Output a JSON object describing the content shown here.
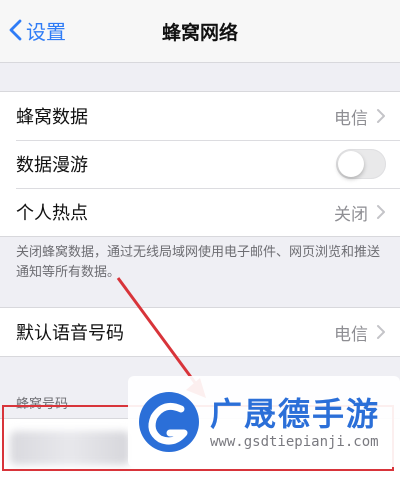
{
  "nav": {
    "back_label": "设置",
    "title": "蜂窝网络"
  },
  "cellular": {
    "cellular_data": {
      "label": "蜂窝数据",
      "value": "电信"
    },
    "roaming": {
      "label": "数据漫游",
      "on": false
    },
    "hotspot": {
      "label": "个人热点",
      "value": "关闭"
    }
  },
  "note": "关闭蜂窝数据，通过无线局域网使用电子邮件、网页浏览和推送通知等所有数据。",
  "voice": {
    "label": "默认语音号码",
    "value": "电信"
  },
  "number_section": {
    "header": "蜂窝号码"
  },
  "watermark": {
    "brand": "广晟德手游",
    "url": "www.gsdtiepianji.com"
  },
  "colors": {
    "accent": "#2f7cf6",
    "highlight": "#d8343a",
    "brand": "#2b6fd8"
  }
}
